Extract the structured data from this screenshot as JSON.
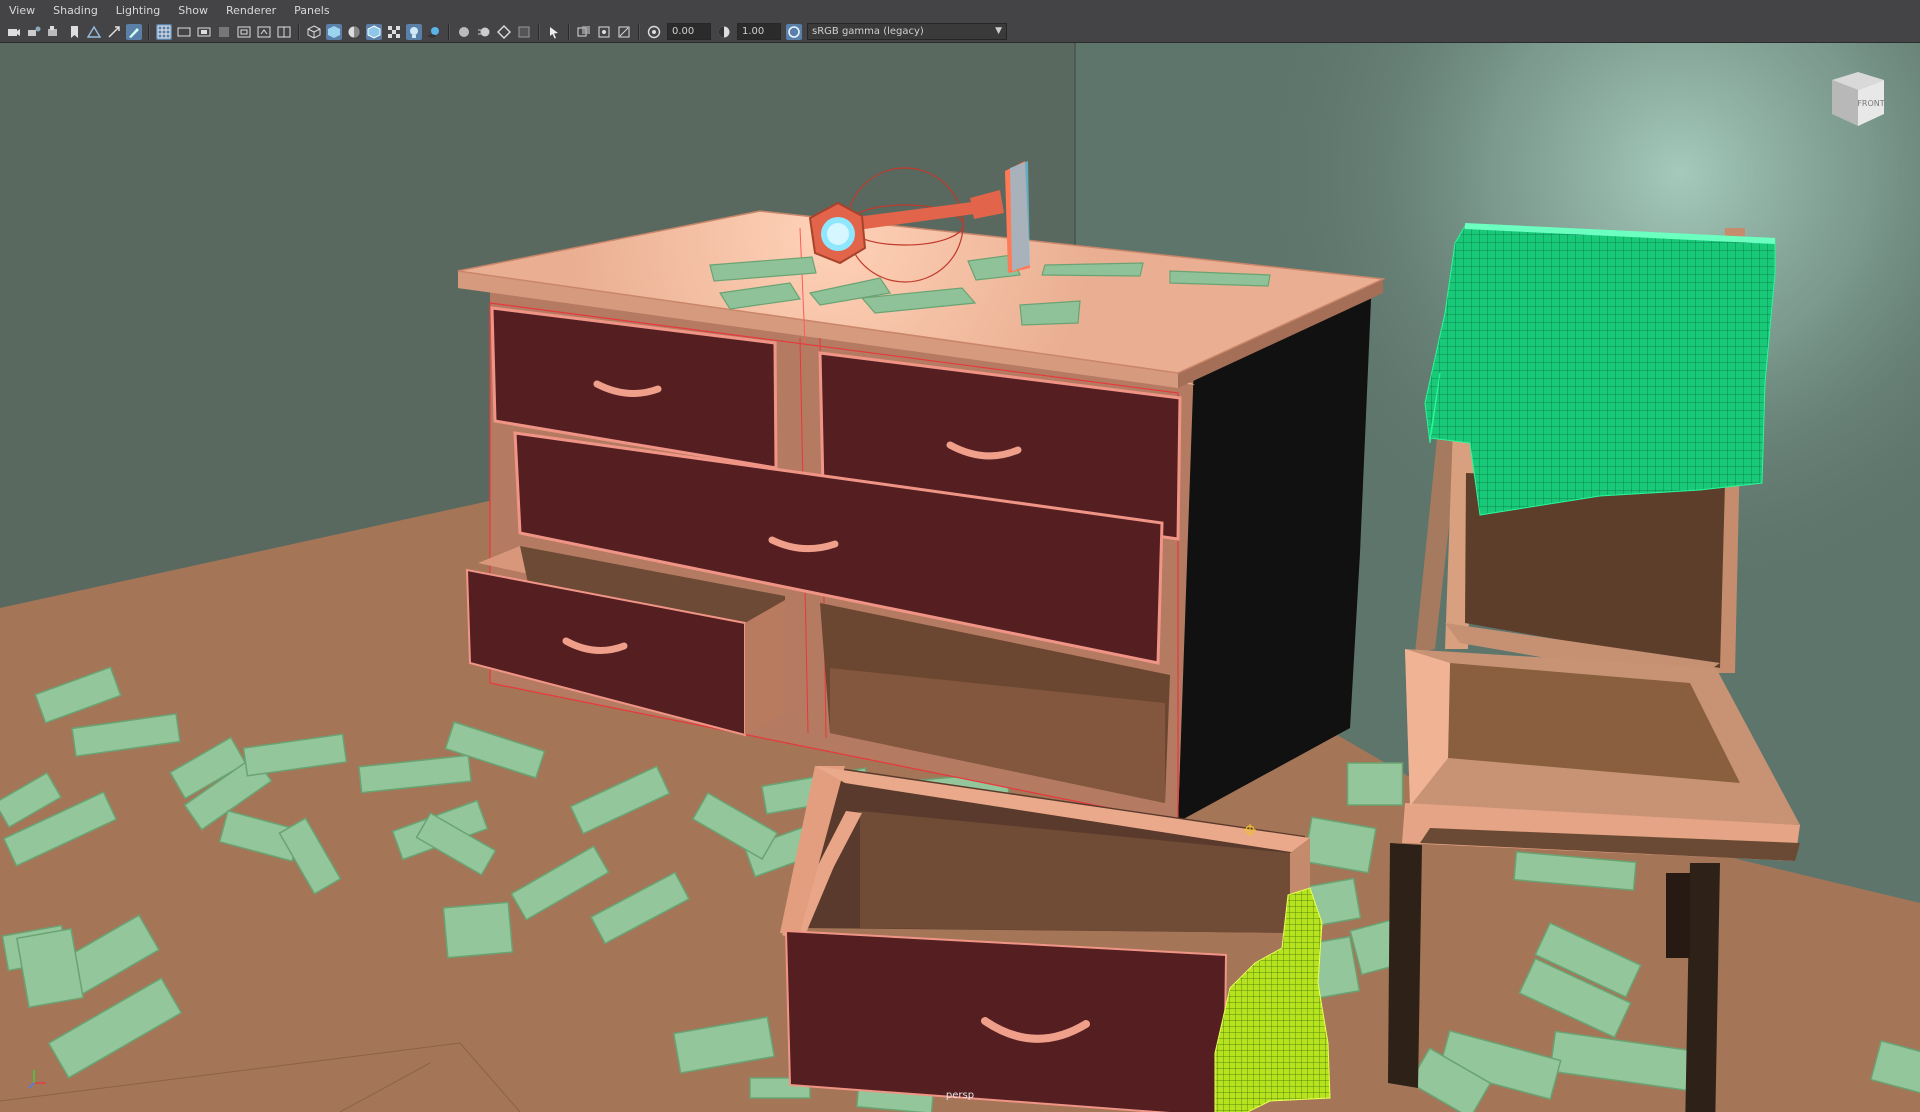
{
  "menu": {
    "items": [
      "View",
      "Shading",
      "Lighting",
      "Show",
      "Renderer",
      "Panels"
    ]
  },
  "toolbar": {
    "exposure_value": "0.00",
    "gamma_value": "1.00",
    "color_space": "sRGB gamma (legacy)",
    "icons": [
      "camera-icon",
      "camera-attributes-icon",
      "bookmark-icon",
      "image-plane-icon",
      "grid-icon",
      "wireframe-icon",
      "smooth-shade-icon",
      "textured-icon",
      "lights-icon",
      "shadows-icon",
      "isolate-select-icon",
      "xray-icon",
      "exposure-icon",
      "gamma-icon",
      "color-management-icon"
    ]
  },
  "viewport": {
    "camera_label": "persp",
    "viewcube_face": "FRONT"
  },
  "colors": {
    "wall_left": "#5a6b61",
    "wall_right": "#5f766c",
    "floor": "#a47557",
    "dresser_top": "#eeb497",
    "drawer_face": "#551f22",
    "paper": "#94c59a",
    "cloth": "#22d07c",
    "cloth_yellow": "#c8e62a",
    "wire": "#ff3a3a"
  }
}
